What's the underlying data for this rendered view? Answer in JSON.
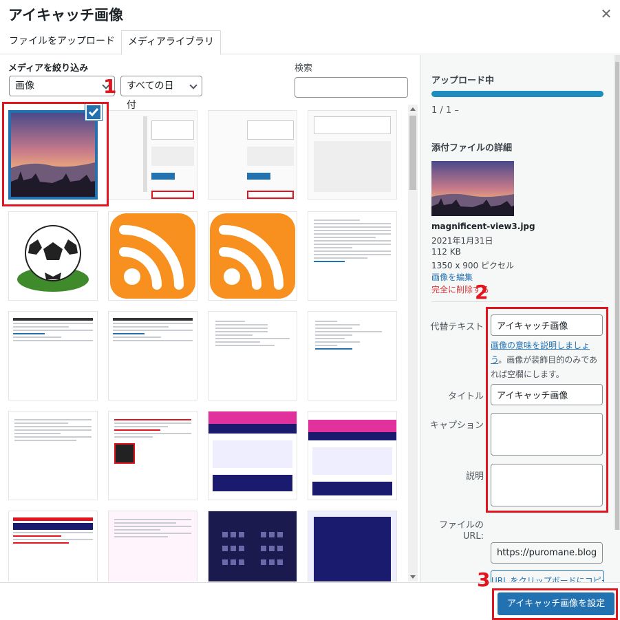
{
  "modal": {
    "title": "アイキャッチ画像",
    "close_icon": "close-icon"
  },
  "tabs": [
    {
      "label": "ファイルをアップロード"
    },
    {
      "label": "メディアライブラリ"
    }
  ],
  "filter": {
    "heading": "メディアを絞り込み",
    "type_value": "画像",
    "date_value": "すべての日付",
    "search_label": "検索",
    "search_value": ""
  },
  "sidebar": {
    "uploading_heading": "アップロード中",
    "progress": 1.0,
    "upload_count": "1 / 1 –",
    "details_heading": "添付ファイルの詳細",
    "filename": "magnificent-view3.jpg",
    "date": "2021年1月31日",
    "size": "112 KB",
    "dimensions": "1350 x 900 ピクセル",
    "edit_link": "画像を編集",
    "delete_link": "完全に削除する",
    "alt_label": "代替テキスト",
    "alt_value": "アイキャッチ画像",
    "alt_help_link": "画像の意味を説明しましょう",
    "alt_help_text": "。画像が装飾目的のみであれば空欄にします。",
    "title_label": "タイトル",
    "title_value": "アイキャッチ画像",
    "caption_label": "キャプション",
    "caption_value": "",
    "description_label": "説明",
    "description_value": "",
    "url_label_1": "ファイルの",
    "url_label_2": "URL:",
    "url_value": "https://puromane.blog/w",
    "copy_button": "URL をクリップボードにコピー"
  },
  "footer": {
    "set_button": "アイキャッチ画像を設定"
  },
  "annotations": {
    "marker_1": "1",
    "marker_2": "2",
    "marker_3": "3"
  },
  "colors": {
    "accent": "#2271b1",
    "annotation_red": "#e2141d",
    "rss_orange": "#f7901e"
  },
  "grid_items": [
    {
      "name": "sunset-landscape"
    },
    {
      "name": "screenshot-editor-panel"
    },
    {
      "name": "screenshot-editor-panel-2"
    },
    {
      "name": "screenshot-featured-image"
    },
    {
      "name": "soccer-ball-icon"
    },
    {
      "name": "rss-icon"
    },
    {
      "name": "rss-icon-2"
    },
    {
      "name": "screenshot-privacy-settings"
    },
    {
      "name": "screenshot-text-page"
    },
    {
      "name": "screenshot-text-page-2"
    },
    {
      "name": "screenshot-form-page"
    },
    {
      "name": "screenshot-media-settings"
    },
    {
      "name": "screenshot-settings-form"
    },
    {
      "name": "screenshot-qr-page"
    },
    {
      "name": "screenshot-ticket-site"
    },
    {
      "name": "screenshot-cinema-site"
    },
    {
      "name": "screenshot-covid-notice"
    },
    {
      "name": "screenshot-pink-page"
    },
    {
      "name": "screenshot-seat-map"
    },
    {
      "name": "screenshot-seat-map-2"
    }
  ]
}
